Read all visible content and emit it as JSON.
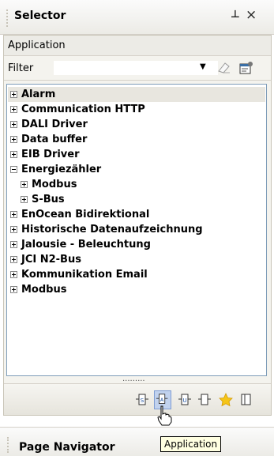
{
  "pane": {
    "title": "Selector",
    "pin_icon": "pin-icon",
    "close_icon": "close-icon",
    "pin_glyph": "⊥",
    "close_glyph": "×"
  },
  "section": {
    "label": "Application"
  },
  "filter": {
    "label": "Filter",
    "value": "",
    "placeholder": ""
  },
  "tree": {
    "items": [
      {
        "label": "Alarm",
        "expanded": false,
        "level": 0,
        "selected": true
      },
      {
        "label": "Communication HTTP",
        "expanded": false,
        "level": 0
      },
      {
        "label": "DALI Driver",
        "expanded": false,
        "level": 0
      },
      {
        "label": "Data buffer",
        "expanded": false,
        "level": 0
      },
      {
        "label": "EIB Driver",
        "expanded": false,
        "level": 0
      },
      {
        "label": "Energiezähler",
        "expanded": true,
        "level": 0
      },
      {
        "label": "Modbus",
        "expanded": false,
        "level": 1
      },
      {
        "label": "S-Bus",
        "expanded": false,
        "level": 1
      },
      {
        "label": "EnOcean Bidirektional",
        "expanded": false,
        "level": 0
      },
      {
        "label": "Historische Datenaufzeichnung",
        "expanded": false,
        "level": 0
      },
      {
        "label": "Jalousie - Beleuchtung",
        "expanded": false,
        "level": 0
      },
      {
        "label": "JCI N2-Bus",
        "expanded": false,
        "level": 0
      },
      {
        "label": "Kommunikation Email",
        "expanded": false,
        "level": 0
      },
      {
        "label": "Modbus",
        "expanded": false,
        "level": 0
      }
    ]
  },
  "splitter": {
    "dots": "·········"
  },
  "toolbar": {
    "buttons": [
      {
        "name": "toolbar-button-s",
        "icon": "s-block-icon",
        "active": false
      },
      {
        "name": "toolbar-button-application",
        "icon": "a-block-icon",
        "active": true
      },
      {
        "name": "toolbar-button-u",
        "icon": "u-block-icon",
        "active": false
      },
      {
        "name": "toolbar-button-empty",
        "icon": "empty-block-icon",
        "active": false
      },
      {
        "name": "toolbar-button-favorites",
        "icon": "star-icon",
        "active": false
      },
      {
        "name": "toolbar-button-panel",
        "icon": "panel-icon",
        "active": false
      }
    ]
  },
  "tooltip": {
    "text": "Application"
  },
  "bottom_pane": {
    "title": "Page Navigator"
  },
  "colors": {
    "active_button_bg": "#c1d2ee",
    "tooltip_bg": "#ffffe1",
    "tree_border": "#7f9db9",
    "star": "#f5c518"
  }
}
